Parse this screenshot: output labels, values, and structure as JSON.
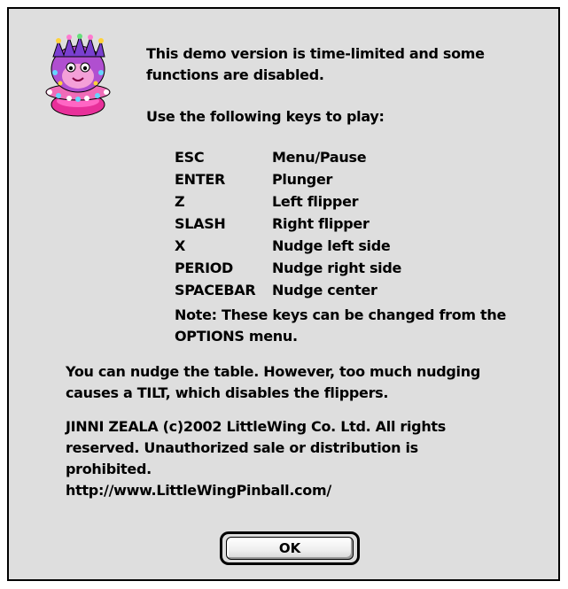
{
  "dialog": {
    "intro_line1": "This demo version is time-limited and some",
    "intro_line2": "functions are disabled.",
    "keys_heading": "Use the following keys to play:",
    "keys": [
      {
        "key": "ESC",
        "action": "Menu/Pause"
      },
      {
        "key": "ENTER",
        "action": "Plunger"
      },
      {
        "key": "Z",
        "action": "Left flipper"
      },
      {
        "key": "SLASH",
        "action": "Right flipper"
      },
      {
        "key": "X",
        "action": "Nudge left side"
      },
      {
        "key": "PERIOD",
        "action": "Nudge right side"
      },
      {
        "key": "SPACEBAR",
        "action": "Nudge center"
      }
    ],
    "note_line1": "Note: These keys can be changed from the",
    "note_line2": "OPTIONS menu.",
    "nudge_line1": "You can nudge the table. However, too much nudging",
    "nudge_line2": "causes a TILT, which disables the flippers.",
    "copyright_line1": "JINNI ZEALA (c)2002 LittleWing Co. Ltd. All rights",
    "copyright_line2": "reserved. Unauthorized sale or distribution is",
    "copyright_line3": "prohibited.",
    "url": "http://www.LittleWingPinball.com/",
    "ok_label": "OK",
    "app_icon": "pinball-character-icon"
  },
  "colors": {
    "dialog_bg": "#dedede",
    "border": "#000000",
    "page_bg": "#ffffff"
  }
}
